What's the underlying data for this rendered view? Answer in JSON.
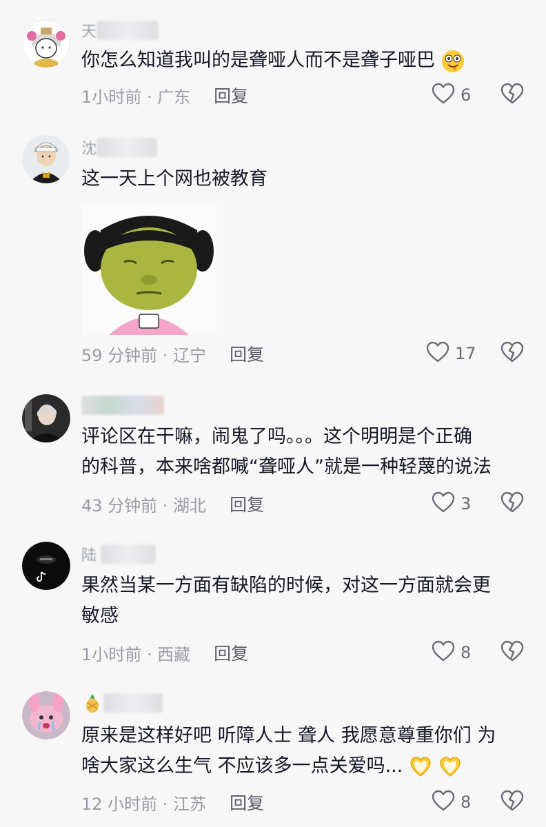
{
  "comments": [
    {
      "username_initial": "天",
      "text": "你怎么知道我叫的是聋哑人而不是聋子哑巴",
      "time_location": "1小时前 · 广东",
      "reply_label": "回复",
      "likes": "6",
      "emoji": "drooling-face-emoji"
    },
    {
      "username_initial": "沈",
      "text": "这一天上个网也被教育",
      "sticker": "yellow-girl-meme-sticker",
      "time_location": "59 分钟前 · 辽宁",
      "reply_label": "回复",
      "likes": "17"
    },
    {
      "username_initial": "",
      "text_line1": "评论区在干嘛，闹鬼了吗。。。这个明明是个正确",
      "text_line2": "的科普，本来啥都喊“聋哑人”就是一种轻蔑的说法",
      "time_location": "43 分钟前 · 湖北",
      "reply_label": "回复",
      "likes": "3"
    },
    {
      "username_initial": "陆",
      "text_line1": "果然当某一方面有缺陷的时候，对这一方面就会更",
      "text_line2": "敏感",
      "time_location": "1小时前 · 西藏",
      "reply_label": "回复",
      "likes": "8"
    },
    {
      "username_initial": "",
      "text_line1": "原来是这样好吧 听障人士 聋人 我愿意尊重你们 为",
      "text_line2": "啥大家这么生气 不应该多一点关爱吗...",
      "time_location": "12 小时前 · 江苏",
      "reply_label": "回复",
      "likes": "8",
      "emoji": "heart-hands-emoji"
    }
  ],
  "colors": {
    "background": "#f7f7f8",
    "text": "#161823",
    "meta": "#9a9ca3",
    "icon": "#6a6c74"
  }
}
